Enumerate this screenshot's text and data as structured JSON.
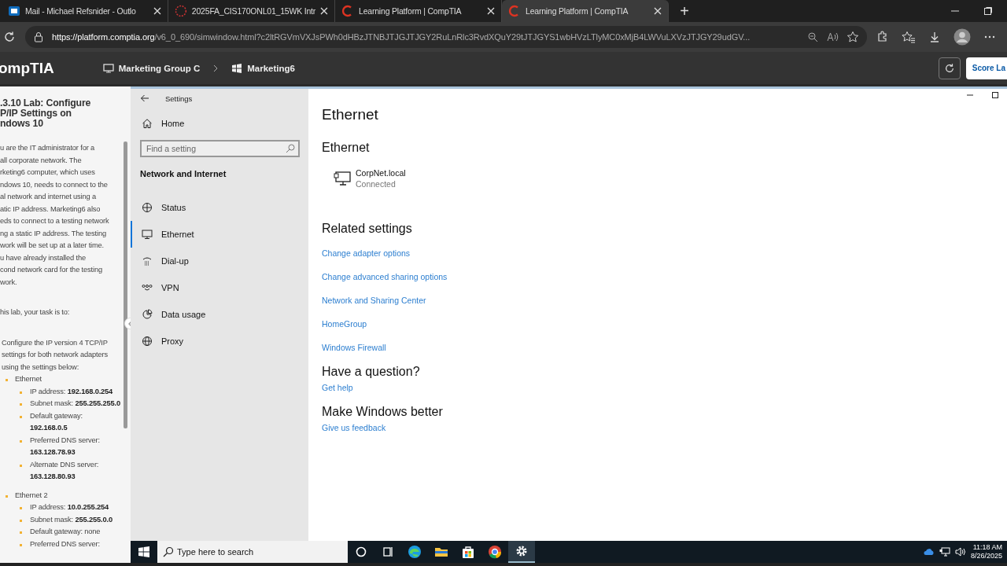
{
  "browser": {
    "tabs": [
      {
        "kind": "mail",
        "title": "Mail - Michael Refsnider - Outlo",
        "selected": false
      },
      {
        "kind": "course",
        "title": "2025FA_CIS170ONL01_15WK Intr",
        "selected": false
      },
      {
        "kind": "comptia",
        "title": "Learning Platform | CompTIA",
        "selected": false
      },
      {
        "kind": "comptia",
        "title": "Learning Platform | CompTIA",
        "selected": true
      }
    ],
    "new_tab": "+",
    "url_host": "https://platform.comptia.org",
    "url_path": "/v6_0_690/simwindow.html?c2ltRGVmVXJsPWh0dHBzJTNBJTJGJTJGY2RuLnRlc3RvdXQuY29tJTJGYS1wbHVzLTlyMC0xMjB4LWVuLXVzJTJGY29udGV..."
  },
  "app_header": {
    "logo": "ompTIA",
    "breadcrumbs": [
      "Marketing Group C",
      "Marketing6"
    ],
    "score_button": "Score La"
  },
  "lab": {
    "title_lines": [
      ".3.10 Lab: Configure",
      "P/IP Settings on",
      "ndows 10"
    ],
    "intro_lines": [
      "u are the IT administrator for a",
      "all corporate network. The",
      "rketing6 computer, which uses",
      "ndows 10, needs to connect to the",
      "al network and internet using a",
      "atic IP address. Marketing6 also",
      "eds to connect to a testing network",
      "ng a static IP address. The testing",
      "work will be set up at a later time.",
      "u have already installed the",
      "cond network card for the testing",
      "work."
    ],
    "task_line": "his lab, your task is to:",
    "step": "Configure the IP version 4 TCP/IP settings for both network adapters using the settings below:",
    "adapters": [
      {
        "name": "Ethernet",
        "settings": [
          "IP address: **192.168.0.254**",
          "Subnet mask: **255.255.255.0**",
          "Default gateway: **192.168.0.5**",
          "Preferred DNS server: **163.128.78.93**",
          "Alternate DNS server: **163.128.80.93**"
        ]
      },
      {
        "name": "Ethernet 2",
        "settings": [
          "IP address: **10.0.255.254**",
          "Subnet mask: **255.255.0.0**",
          "Default gateway: none",
          "Preferred DNS server:"
        ]
      }
    ]
  },
  "settings": {
    "title": "Settings",
    "home": "Home",
    "search": {
      "placeholder": "Find a setting"
    },
    "section": "Network and Internet",
    "nav": [
      {
        "kind": "status",
        "label": "Status",
        "selected": false
      },
      {
        "kind": "ethernet",
        "label": "Ethernet",
        "selected": true
      },
      {
        "kind": "dialup",
        "label": "Dial-up",
        "selected": false
      },
      {
        "kind": "vpn",
        "label": "VPN",
        "selected": false
      },
      {
        "kind": "data",
        "label": "Data usage",
        "selected": false
      },
      {
        "kind": "proxy",
        "label": "Proxy",
        "selected": false
      }
    ],
    "page_title": "Ethernet",
    "adapter_heading": "Ethernet",
    "network": {
      "name": "CorpNet.local",
      "status": "Connected"
    },
    "related_heading": "Related settings",
    "related_links": [
      "Change adapter options",
      "Change advanced sharing options",
      "Network and Sharing Center",
      "HomeGroup",
      "Windows Firewall"
    ],
    "question_heading": "Have a question?",
    "question_link": "Get help",
    "better_heading": "Make Windows better",
    "better_link": "Give us feedback"
  },
  "taskbar": {
    "search_placeholder": "Type here to search",
    "apps": [
      {
        "kind": "cortana",
        "selected": false
      },
      {
        "kind": "taskview",
        "selected": false
      },
      {
        "kind": "edge",
        "selected": false
      },
      {
        "kind": "explorer",
        "selected": false
      },
      {
        "kind": "store",
        "selected": false
      },
      {
        "kind": "chrome",
        "selected": false
      },
      {
        "kind": "settings",
        "selected": true
      }
    ],
    "time": "11:18 AM",
    "date": "8/26/2025"
  }
}
